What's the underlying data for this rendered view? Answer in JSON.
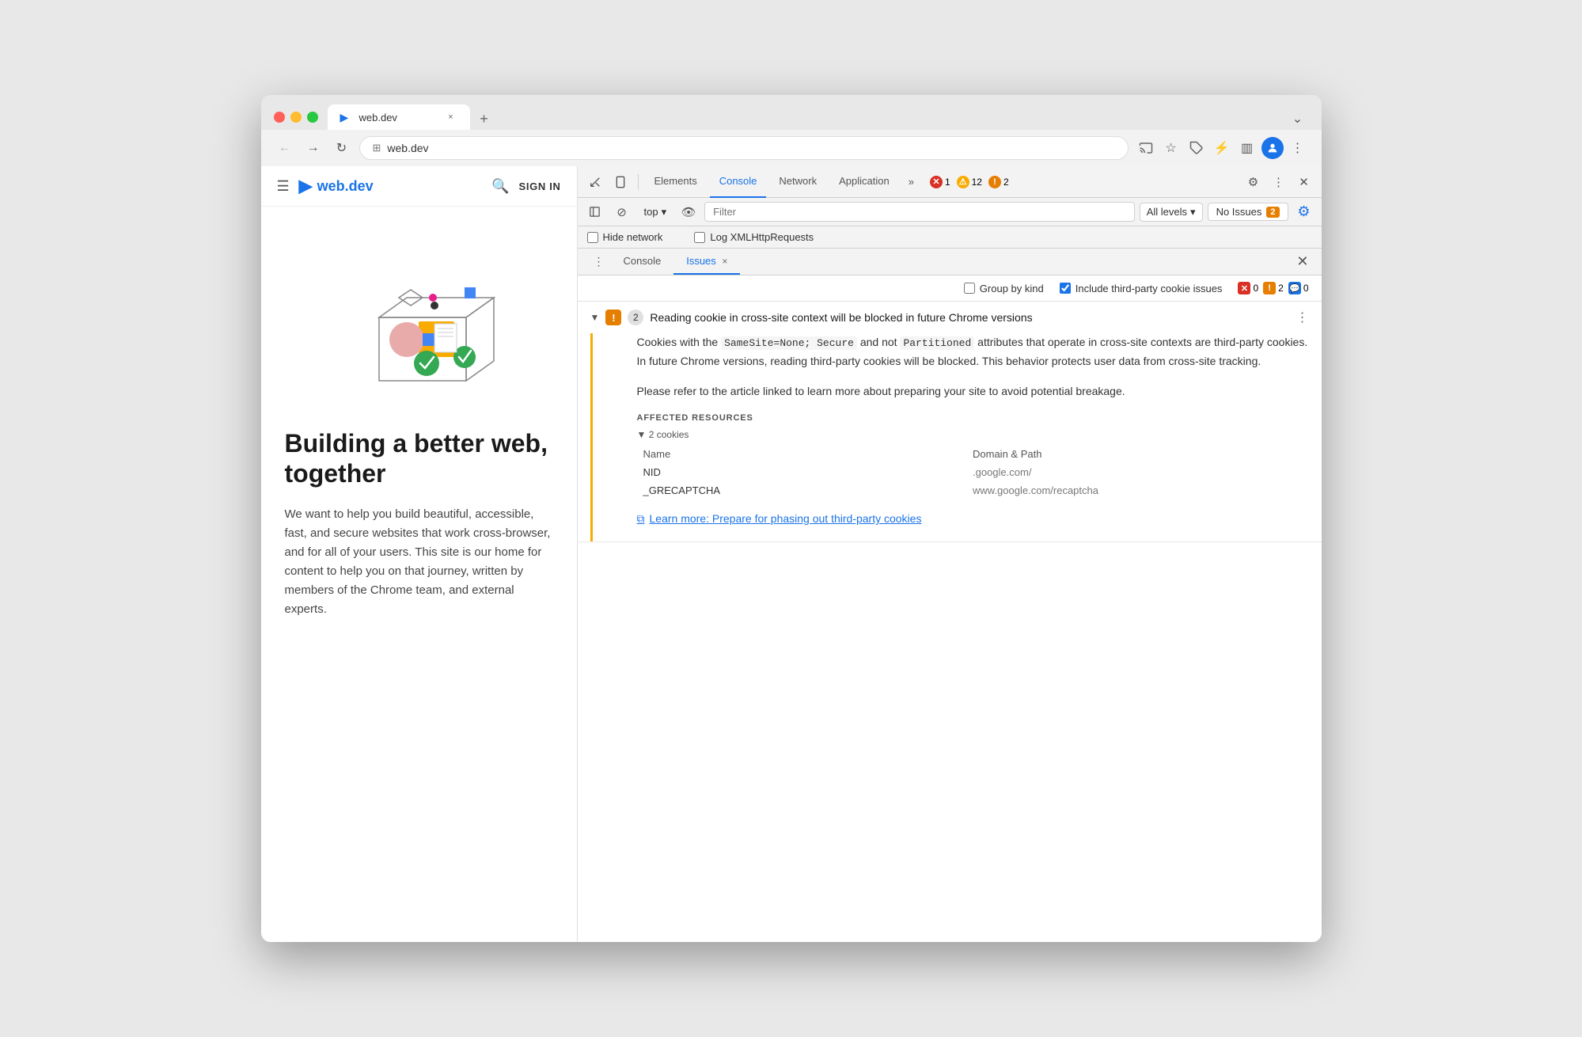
{
  "browser": {
    "tab": {
      "favicon": "▶",
      "title": "web.dev",
      "close": "×"
    },
    "new_tab": "+",
    "overflow": "⌄",
    "nav": {
      "back": "←",
      "forward": "→",
      "reload": "↻",
      "address_icon": "⊞",
      "address": "web.dev",
      "cast": "⊡",
      "bookmark": "☆",
      "extension": "☰",
      "devtools_toggle": "⚡",
      "sidebar_toggle": "▥",
      "profile": "👤",
      "menu": "⋮"
    }
  },
  "website": {
    "hamburger": "☰",
    "logo_icon": "▶",
    "logo_text": "web.dev",
    "search_icon": "🔍",
    "sign_in": "SIGN IN",
    "heading": "Building a better web, together",
    "description": "We want to help you build beautiful, accessible, fast, and secure websites that work cross-browser, and for all of your users. This site is our home for content to help you on that journey, written by members of the Chrome team, and external experts."
  },
  "devtools": {
    "toolbar": {
      "inspect_icon": "⊹",
      "device_icon": "▭",
      "tabs": [
        {
          "label": "Elements",
          "active": false
        },
        {
          "label": "Console",
          "active": false
        },
        {
          "label": "Network",
          "active": false
        },
        {
          "label": "Application",
          "active": false
        }
      ],
      "more_tabs": "»",
      "badges": {
        "errors": {
          "count": "1",
          "icon": "✕"
        },
        "warnings": {
          "count": "12",
          "icon": "⚠"
        },
        "issues": {
          "count": "2",
          "icon": "!"
        }
      },
      "settings_icon": "⚙",
      "more_icon": "⋮",
      "close_icon": "✕"
    },
    "secondary": {
      "sidebar_toggle": "▤",
      "clear_icon": "⊘",
      "context": "top",
      "context_arrow": "▾",
      "eye_icon": "👁",
      "filter_placeholder": "Filter",
      "level": "All levels",
      "level_arrow": "▾",
      "no_issues_label": "No Issues",
      "issues_count": "2",
      "settings_icon": "⚙"
    },
    "checkboxes": {
      "hide_network": "Hide network",
      "log_xml": "Log XMLHttpRequests"
    },
    "issues_tabs": {
      "more_icon": "⋮",
      "console_label": "Console",
      "issues_label": "Issues",
      "issues_close": "×",
      "close_panel": "✕"
    },
    "issues_options": {
      "group_by_kind": "Group by kind",
      "third_party": "Include third-party cookie issues",
      "counts": {
        "errors": "0",
        "warnings": "2",
        "info": "0"
      }
    },
    "issue": {
      "chevron": "▼",
      "warning_icon": "!",
      "badge_num": "2",
      "title": "Reading cookie in cross-site context will be blocked in future Chrome versions",
      "menu": "⋮",
      "description_parts": {
        "intro": "Cookies with the ",
        "code1": "SameSite=None; Secure",
        "mid1": " and not ",
        "code2": "Partitioned",
        "mid2": " attributes that operate in cross-site contexts are third-party cookies. In future Chrome versions, reading third-party cookies will be blocked. This behavior protects user data from cross-site tracking.",
        "para2": "Please refer to the article linked to learn more about preparing your site to avoid potential breakage."
      },
      "affected_resources_label": "AFFECTED RESOURCES",
      "cookies_count": "▼ 2 cookies",
      "table": {
        "col_name": "Name",
        "col_domain": "Domain & Path",
        "rows": [
          {
            "name": "NID",
            "domain": ".google.com/"
          },
          {
            "name": "_GRECAPTCHA",
            "domain": "www.google.com/recaptcha"
          }
        ]
      },
      "link_icon": "⧉",
      "link_text": "Learn more: Prepare for phasing out third-party cookies"
    }
  }
}
